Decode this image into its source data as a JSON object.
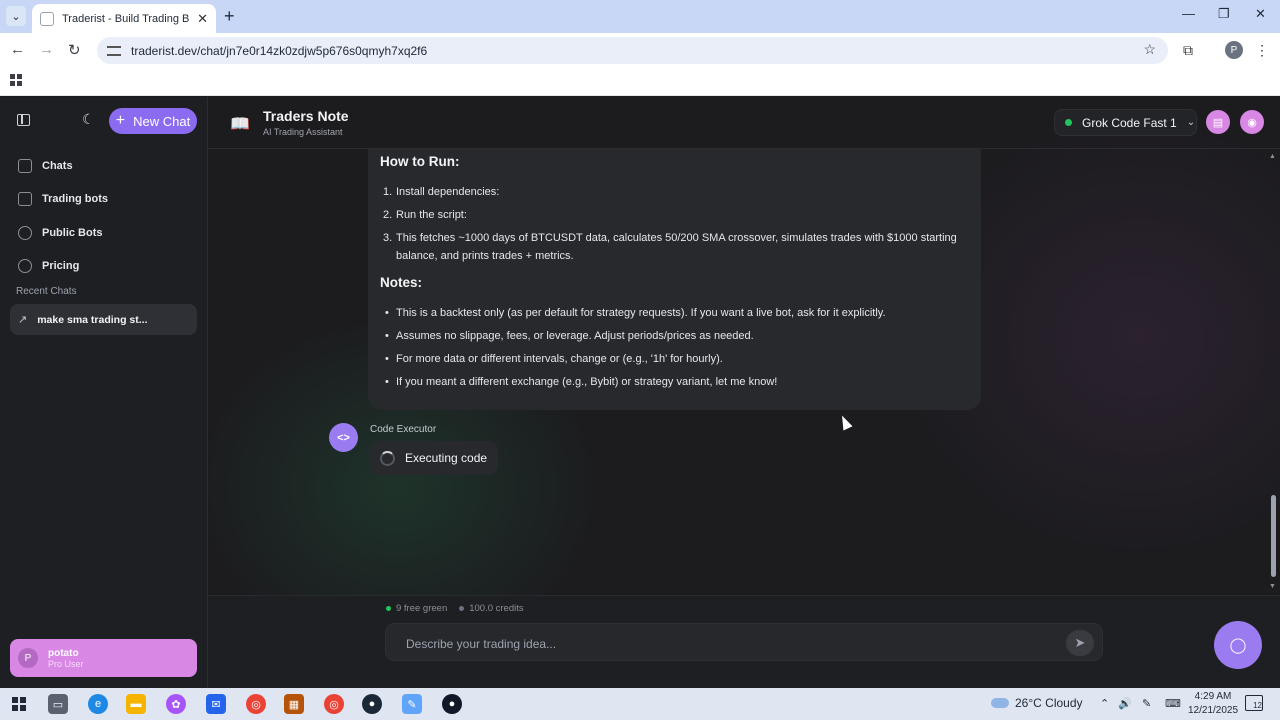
{
  "browser": {
    "tab_title": "Traderist - Build Trading Bots w",
    "url": "traderist.dev/chat/jn7e0r14zk0zdjw5p676s0qmyh7xq2f6",
    "profile_initial": "P"
  },
  "sidebar": {
    "new_chat_label": "New Chat",
    "items": [
      {
        "label": "Chats",
        "icon": "chat-icon"
      },
      {
        "label": "Trading bots",
        "icon": "bot-icon"
      },
      {
        "label": "Public Bots",
        "icon": "globe-icon"
      },
      {
        "label": "Pricing",
        "icon": "dollar-icon"
      }
    ],
    "recent_heading": "Recent Chats",
    "recent": [
      {
        "label": "make sma trading st...",
        "icon": "trend-icon"
      }
    ],
    "user": {
      "initial": "P",
      "name": "potato",
      "role": "Pro User"
    }
  },
  "header": {
    "title": "Traders Note",
    "subtitle": "AI Trading Assistant",
    "model": "Grok Code Fast 1",
    "model_status_color": "#22c55e"
  },
  "message": {
    "how_to_run_heading": "How to Run:",
    "steps": [
      "Install dependencies:",
      "Run the script:",
      "This fetches ~1000 days of BTCUSDT data, calculates 50/200 SMA crossover, simulates trades with $1000 starting balance, and prints trades + metrics."
    ],
    "notes_heading": "Notes:",
    "notes": [
      "This is a backtest only (as per default for strategy requests). If you want a live bot, ask for it explicitly.",
      "Assumes no slippage, fees, or leverage. Adjust periods/prices as needed.",
      "For more data or different intervals, change or (e.g., '1h' for hourly).",
      "If you meant a different exchange (e.g., Bybit) or strategy variant, let me know!"
    ]
  },
  "executor": {
    "name": "Code Executor",
    "status": "Executing code",
    "avatar_glyph": "<>"
  },
  "composer": {
    "free_green": "9 free green",
    "credits": "100.0 credits",
    "placeholder": "Describe your trading idea..."
  },
  "taskbar": {
    "weather": "26°C  Cloudy",
    "time": "4:29 AM",
    "date": "12/21/2025",
    "notifications": "12"
  },
  "colors": {
    "accent": "#8b6cf0",
    "pink": "#d887e4",
    "status_green": "#22c55e"
  }
}
